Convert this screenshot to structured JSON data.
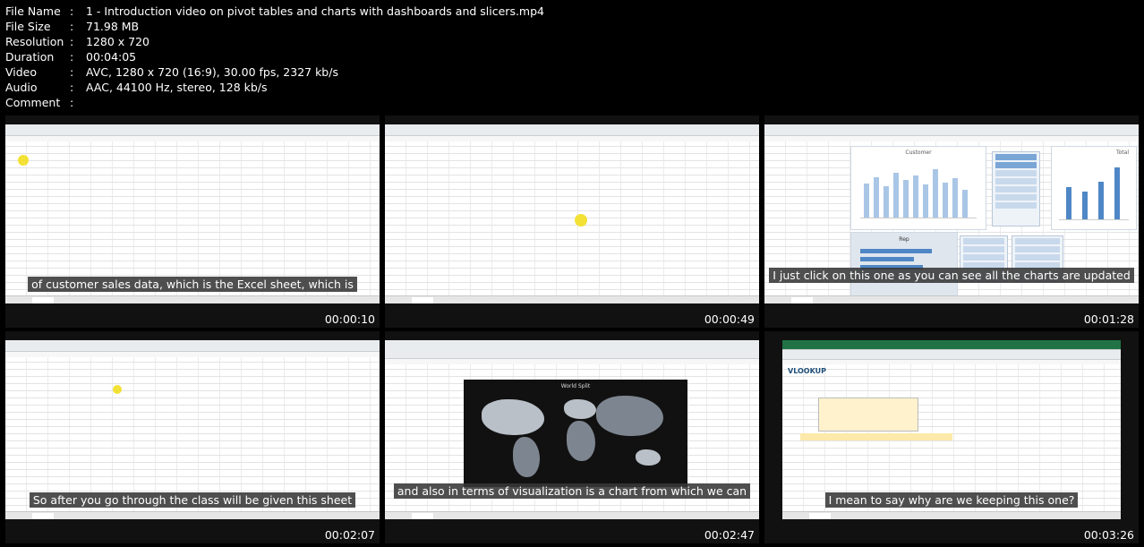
{
  "file_info": [
    {
      "key": "File Name",
      "value": "1 - Introduction video on pivot tables and charts with dashboards and slicers.mp4"
    },
    {
      "key": "File Size",
      "value": "71.98 MB"
    },
    {
      "key": "Resolution",
      "value": "1280 x 720"
    },
    {
      "key": "Duration",
      "value": "00:04:05"
    },
    {
      "key": "Video",
      "value": "AVC, 1280 x 720 (16:9), 30.00 fps, 2327 kb/s"
    },
    {
      "key": "Audio",
      "value": "AAC, 44100 Hz, stereo, 128 kb/s"
    },
    {
      "key": "Comment",
      "value": ""
    }
  ],
  "separator": ":",
  "thumbnails": [
    {
      "caption": "of customer sales data, which is the Excel sheet, which is",
      "timestamp": "00:00:10"
    },
    {
      "caption": "",
      "timestamp": "00:00:49"
    },
    {
      "caption": "I just click on this one as you can see all the charts are updated",
      "timestamp": "00:01:28"
    },
    {
      "caption": "So after you go through the class will be given this sheet",
      "timestamp": "00:02:07"
    },
    {
      "caption": "and also in terms of visualization is a chart from which we can",
      "timestamp": "00:02:47"
    },
    {
      "caption": "I mean to say why are we keeping this one?",
      "timestamp": "00:03:26"
    }
  ],
  "embedded_labels": {
    "pivot_chart_title": "Customer",
    "total_chart_title": "Total",
    "rep_chart_title": "Rep",
    "map_title": "World Split",
    "vlookup_heading": "VLOOKUP"
  },
  "colors": {
    "background": "#000000",
    "excel_green": "#217346",
    "chart_blue": "#4f87c6",
    "caption_bg": "#373737"
  }
}
